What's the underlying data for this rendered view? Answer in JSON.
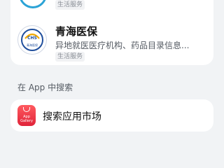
{
  "results": {
    "items": [
      {
        "name": "",
        "description": "",
        "tag": "生活服务",
        "icon": "partial-round-app-icon"
      },
      {
        "name": "青海医保",
        "description": "异地就医医疗机构、药品目录信息...",
        "tag": "生活服务",
        "icon": "qinghai-medical-insurance-logo-icon",
        "icon_text": "CHS",
        "icon_caption": "青海医保"
      }
    ]
  },
  "app_search": {
    "section_title": "在 App 中搜索",
    "item_label": "搜索应用市场",
    "icon": "app-gallery-icon",
    "icon_text_1": "App",
    "icon_text_2": "Gallery"
  },
  "colors": {
    "background": "#f1f3f5",
    "card": "#ffffff",
    "gallery_red": "#e0243a",
    "insurance_blue": "#1f4e9c"
  }
}
